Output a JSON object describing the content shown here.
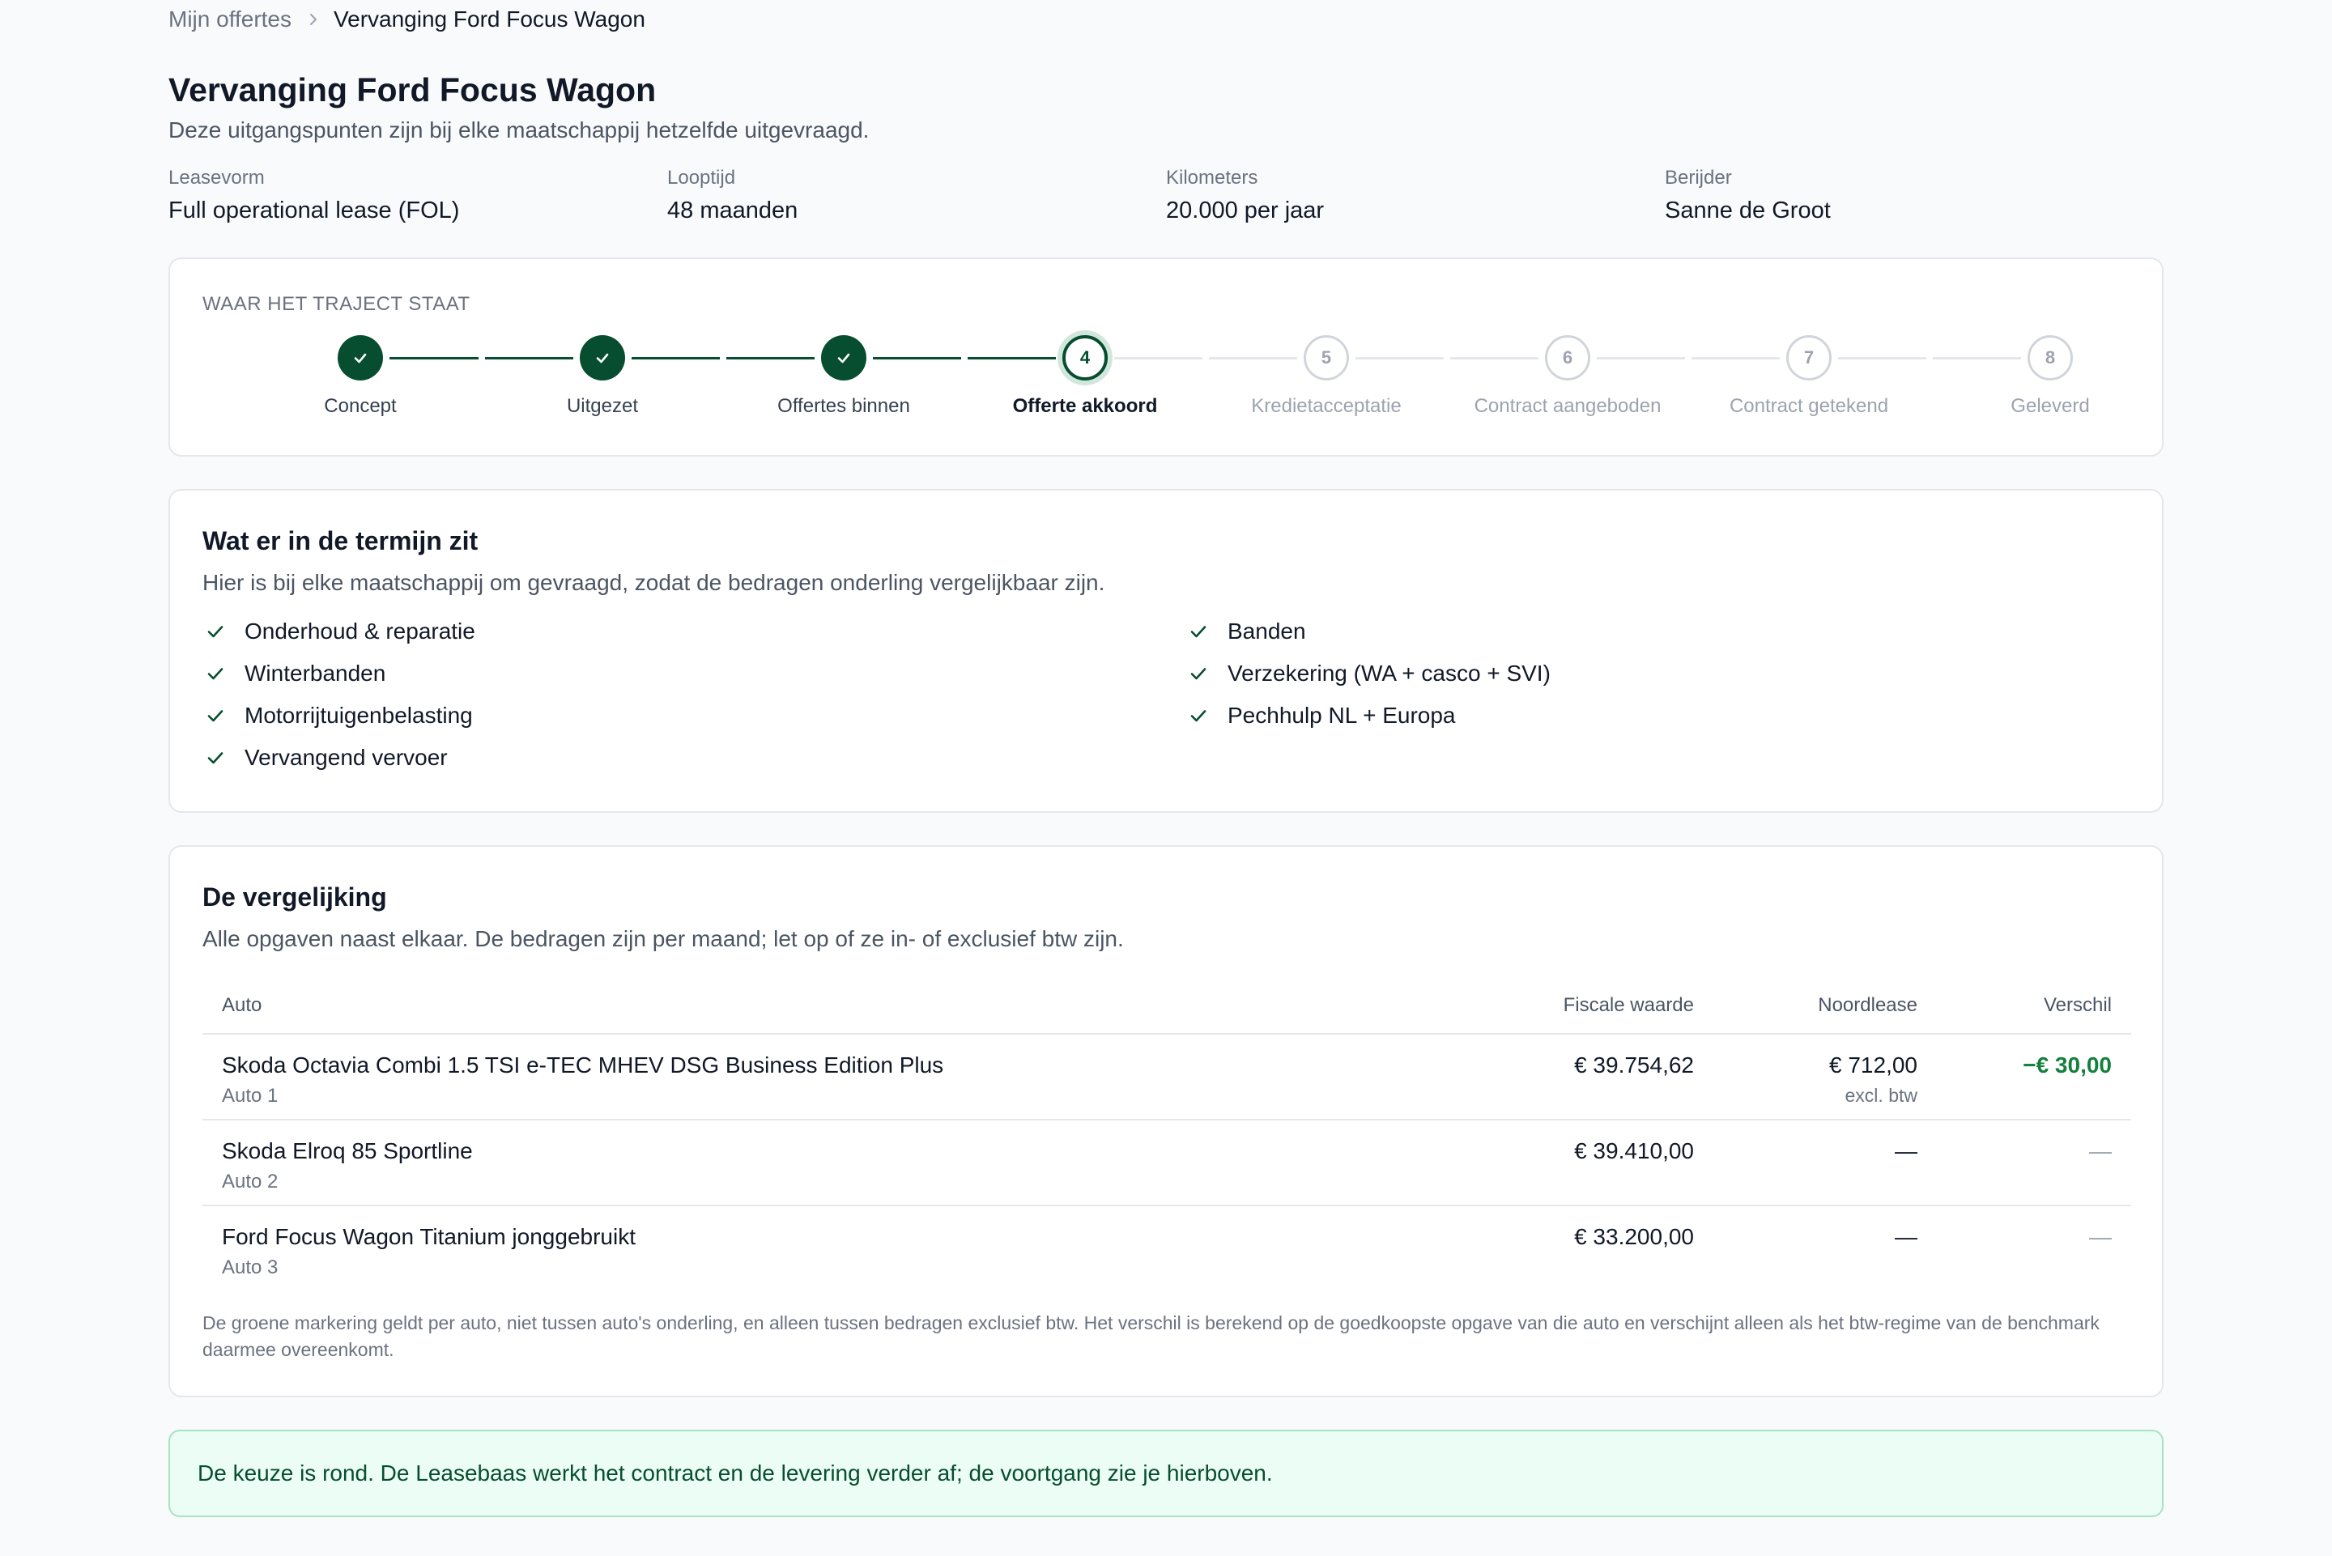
{
  "breadcrumb": {
    "parent": "Mijn offertes",
    "current": "Vervanging Ford Focus Wagon"
  },
  "header": {
    "title": "Vervanging Ford Focus Wagon",
    "subtitle": "Deze uitgangspunten zijn bij elke maatschappij hetzelfde uitgevraagd."
  },
  "params": [
    {
      "label": "Leasevorm",
      "value": "Full operational lease (FOL)"
    },
    {
      "label": "Looptijd",
      "value": "48 maanden"
    },
    {
      "label": "Kilometers",
      "value": "20.000 per jaar"
    },
    {
      "label": "Berijder",
      "value": "Sanne de Groot"
    }
  ],
  "progress": {
    "title": "WAAR HET TRAJECT STAAT",
    "steps": [
      {
        "number": "1",
        "label": "Concept",
        "state": "done"
      },
      {
        "number": "2",
        "label": "Uitgezet",
        "state": "done"
      },
      {
        "number": "3",
        "label": "Offertes binnen",
        "state": "done"
      },
      {
        "number": "4",
        "label": "Offerte akkoord",
        "state": "current"
      },
      {
        "number": "5",
        "label": "Kredietacceptatie",
        "state": "todo"
      },
      {
        "number": "6",
        "label": "Contract aangeboden",
        "state": "todo"
      },
      {
        "number": "7",
        "label": "Contract getekend",
        "state": "todo"
      },
      {
        "number": "8",
        "label": "Geleverd",
        "state": "todo"
      }
    ]
  },
  "includes": {
    "title": "Wat er in de termijn zit",
    "subtitle": "Hier is bij elke maatschappij om gevraagd, zodat de bedragen onderling vergelijkbaar zijn.",
    "left": [
      "Onderhoud & reparatie",
      "Winterbanden",
      "Motorrijtuigenbelasting",
      "Vervangend vervoer"
    ],
    "right": [
      "Banden",
      "Verzekering (WA + casco + SVI)",
      "Pechhulp NL + Europa"
    ]
  },
  "comparison": {
    "title": "De vergelijking",
    "subtitle": "Alle opgaven naast elkaar. De bedragen zijn per maand; let op of ze in- of exclusief btw zijn.",
    "columns": {
      "auto": "Auto",
      "fiscal": "Fiscale waarde",
      "noordlease": "Noordlease",
      "diff": "Verschil"
    },
    "rows": [
      {
        "name": "Skoda Octavia Combi 1.5 TSI e-TEC MHEV DSG Business Edition Plus",
        "sub": "Auto 1",
        "fiscal": "€ 39.754,62",
        "noordlease": "€ 712,00",
        "noordlease_note": "excl. btw",
        "diff": "−€ 30,00"
      },
      {
        "name": "Skoda Elroq 85 Sportline",
        "sub": "Auto 2",
        "fiscal": "€ 39.410,00",
        "noordlease": "—",
        "noordlease_note": "",
        "diff": "—"
      },
      {
        "name": "Ford Focus Wagon Titanium jonggebruikt",
        "sub": "Auto 3",
        "fiscal": "€ 33.200,00",
        "noordlease": "—",
        "noordlease_note": "",
        "diff": "—"
      }
    ],
    "footnote": "De groene markering geldt per auto, niet tussen auto's onderling, en alleen tussen bedragen exclusief btw. Het verschil is berekend op de goedkoopste opgave van die auto en verschijnt alleen als het btw-regime van de benchmark daarmee overeenkomt."
  },
  "banner": {
    "text": "De keuze is rond. De Leasebaas werkt het contract en de levering verder af; de voortgang zie je hierboven."
  },
  "colors": {
    "primary": "#064e2f",
    "positive": "#15803d",
    "banner_bg": "#ecfdf5"
  }
}
